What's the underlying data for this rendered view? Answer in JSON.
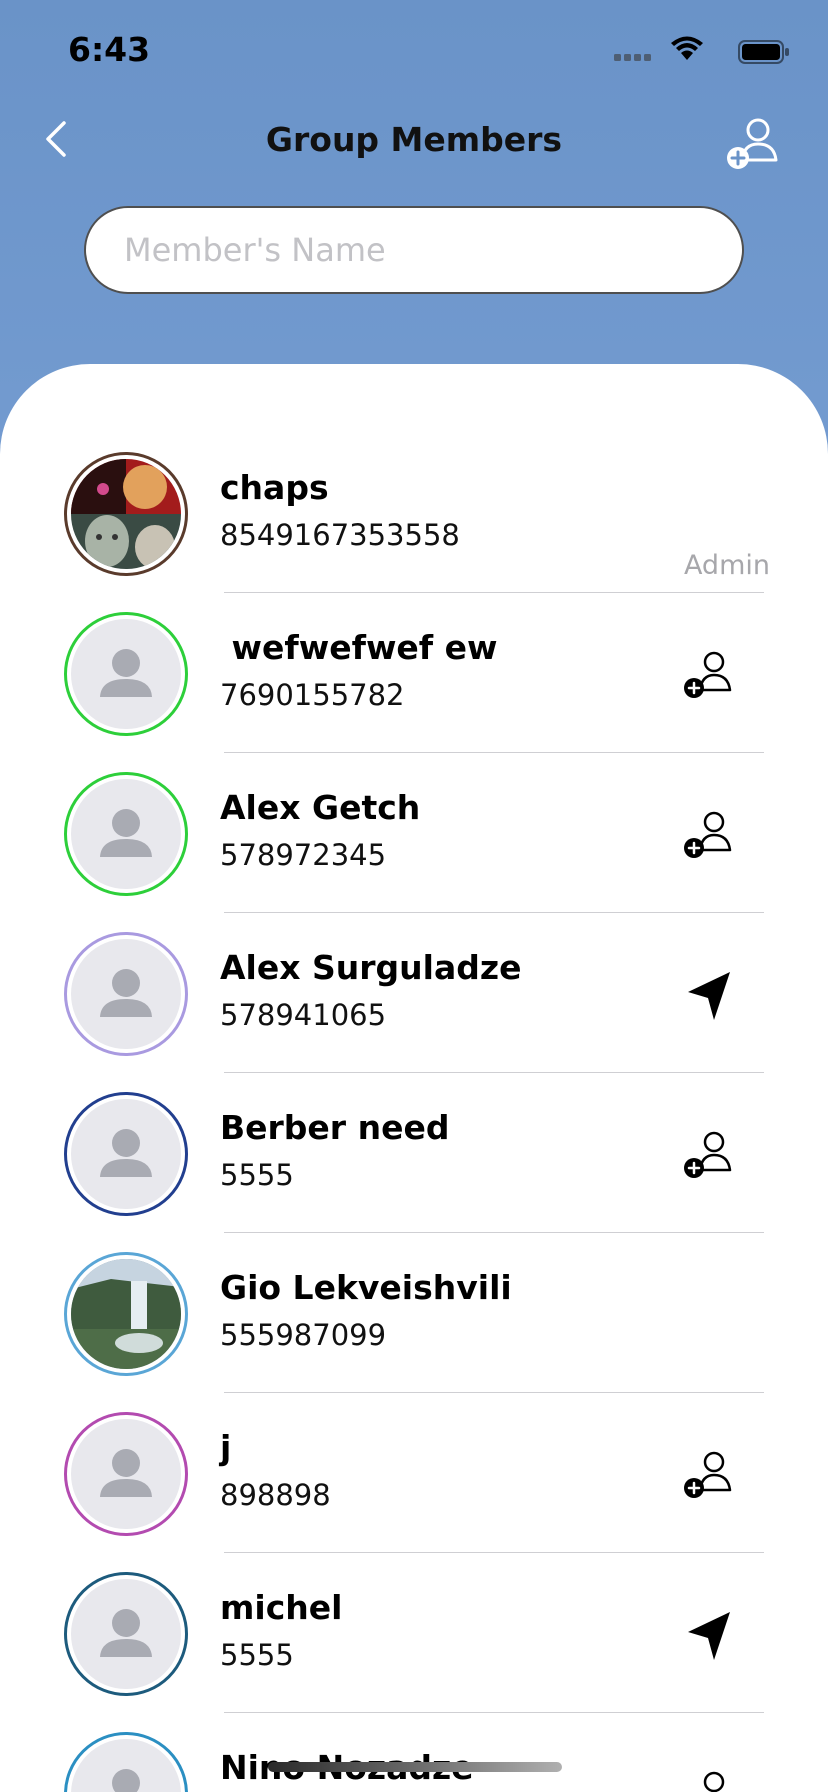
{
  "status_bar": {
    "time": "6:43"
  },
  "nav": {
    "title": "Group Members"
  },
  "search": {
    "placeholder": "Member's Name",
    "value": ""
  },
  "members": [
    {
      "name": "chaps",
      "phone": "8549167353558",
      "role": "Admin",
      "ring_color": "#5a3b2c",
      "avatar": "photo-1",
      "action": "none"
    },
    {
      "name": " wefwefwef ew",
      "phone": "7690155782",
      "role": "",
      "ring_color": "#2dcf3a",
      "avatar": "placeholder",
      "action": "add-user-icon"
    },
    {
      "name": "Alex Getch",
      "phone": "578972345",
      "role": "",
      "ring_color": "#2dcf3a",
      "avatar": "placeholder",
      "action": "add-user-icon"
    },
    {
      "name": "Alex Surguladze",
      "phone": "578941065",
      "role": "",
      "ring_color": "#a99ae0",
      "avatar": "placeholder",
      "action": "send-icon"
    },
    {
      "name": "Berber need",
      "phone": "5555",
      "role": "",
      "ring_color": "#223f8f",
      "avatar": "placeholder",
      "action": "add-user-icon"
    },
    {
      "name": "Gio Lekveishvili",
      "phone": "555987099",
      "role": "",
      "ring_color": "#5aa6d6",
      "avatar": "photo-waterfall",
      "action": "none"
    },
    {
      "name": "j",
      "phone": "898898",
      "role": "",
      "ring_color": "#b34bb0",
      "avatar": "placeholder",
      "action": "add-user-icon"
    },
    {
      "name": "michel",
      "phone": "5555",
      "role": "",
      "ring_color": "#1d5b7d",
      "avatar": "placeholder",
      "action": "send-icon"
    },
    {
      "name": "Nino Nozadze",
      "phone": "",
      "role": "",
      "ring_color": "#2b8fc2",
      "avatar": "placeholder",
      "action": "add-user-icon"
    }
  ]
}
